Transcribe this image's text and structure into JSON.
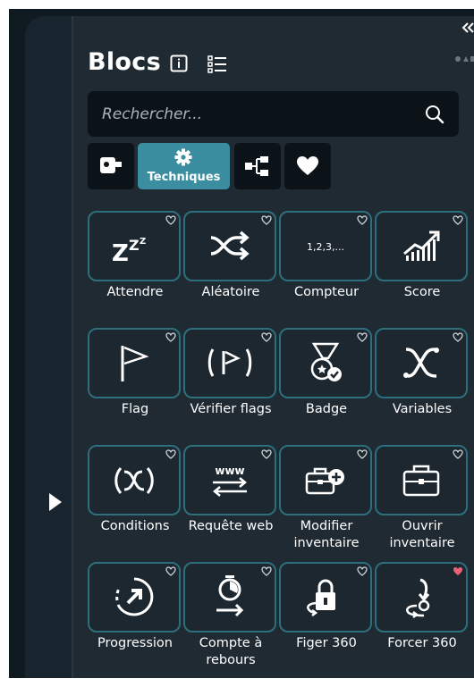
{
  "header": {
    "title": "Blocs"
  },
  "search": {
    "placeholder": "Rechercher..."
  },
  "tabs": [
    {
      "label": "",
      "icon": "robot-icon"
    },
    {
      "label": "Techniques",
      "icon": "gear-icon"
    },
    {
      "label": "",
      "icon": "hierarchy-icon"
    },
    {
      "label": "",
      "icon": "heart-icon"
    }
  ],
  "blocks": [
    {
      "label": "Attendre",
      "icon": "sleep-zzz-icon",
      "favorite": false
    },
    {
      "label": "Aléatoire",
      "icon": "shuffle-icon",
      "favorite": false
    },
    {
      "label": "Compteur",
      "icon": "counter-icon",
      "glyph_text": "1,2,3,...",
      "favorite": false
    },
    {
      "label": "Score",
      "icon": "score-chart-icon",
      "favorite": false
    },
    {
      "label": "Flag",
      "icon": "flag-icon",
      "favorite": false
    },
    {
      "label": "Vérifier flags",
      "icon": "check-flag-icon",
      "favorite": false
    },
    {
      "label": "Badge",
      "icon": "badge-medal-icon",
      "favorite": false
    },
    {
      "label": "Variables",
      "icon": "variable-x-icon",
      "favorite": false
    },
    {
      "label": "Conditions",
      "icon": "condition-x-icon",
      "favorite": false
    },
    {
      "label": "Requête web",
      "icon": "web-request-icon",
      "glyph_text": "www",
      "favorite": false
    },
    {
      "label": "Modifier inventaire",
      "icon": "briefcase-add-icon",
      "favorite": false
    },
    {
      "label": "Ouvrir inventaire",
      "icon": "briefcase-icon",
      "favorite": false
    },
    {
      "label": "Progression",
      "icon": "progress-arrow-icon",
      "favorite": false
    },
    {
      "label": "Compte à rebours",
      "icon": "stopwatch-icon",
      "favorite": false
    },
    {
      "label": "Figer 360",
      "icon": "lock-360-icon",
      "favorite": false
    },
    {
      "label": "Forcer 360",
      "icon": "force-360-icon",
      "favorite": true
    }
  ],
  "colors": {
    "accent": "#3a8ea0",
    "tile_border": "#2e6f7d",
    "panel_bg": "#1f2a33",
    "favorite_heart": "#e8637a",
    "empty_heart": "#cfd5d9"
  }
}
